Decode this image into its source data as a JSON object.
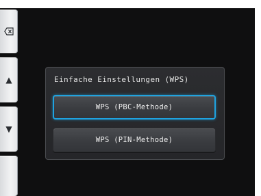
{
  "dialog": {
    "title": "Einfache Einstellungen (WPS)",
    "options": [
      {
        "label": "WPS (PBC-Methode)",
        "selected": true
      },
      {
        "label": "WPS (PIN-Methode)",
        "selected": false
      }
    ]
  },
  "side_buttons": {
    "back_icon": "backspace-icon",
    "up_icon": "triangle-up-icon",
    "down_icon": "triangle-down-icon",
    "up_glyph": "▲",
    "down_glyph": "▼"
  },
  "colors": {
    "focus_outline": "#1fa3e0",
    "screen_background": "#0f0f10",
    "button_face": "#3f4145"
  }
}
